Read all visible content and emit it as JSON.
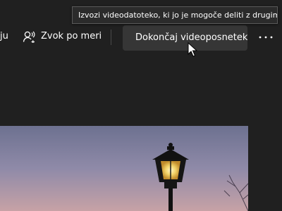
{
  "toolbar": {
    "cut_label": "ju",
    "audio_button": {
      "label": "Zvok po meri",
      "icon": "custom-audio-icon"
    },
    "finish_button": {
      "label": "Dokončaj videoposnetek",
      "icon": "share-export-icon"
    },
    "more_button": {
      "icon": "more-horizontal-icon"
    }
  },
  "tooltip": {
    "text": "Izvozi videodatoteko, ki jo je mogoče deliti z drugimi"
  },
  "preview": {
    "description_icon": "lamppost-image"
  },
  "colors": {
    "background": "#202020",
    "button_hover": "#363636",
    "tooltip_bg": "#2b2b2b",
    "sky_top": "#6a6f8c",
    "sky_bottom": "#c6a3a9"
  }
}
